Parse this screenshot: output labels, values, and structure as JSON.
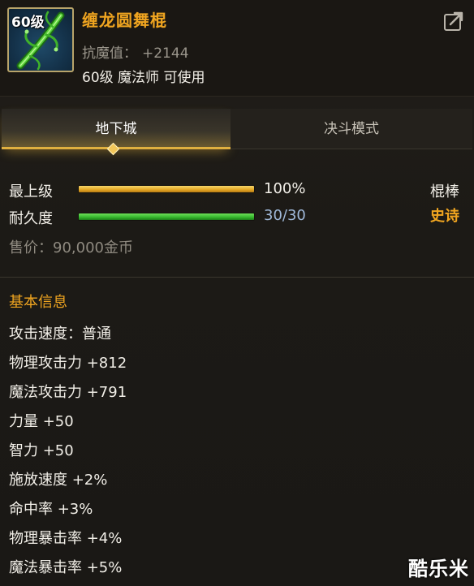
{
  "item": {
    "level_badge": "60级",
    "name": "缠龙圆舞棍",
    "resist_label": "抗魔值：",
    "resist_value": "+2144",
    "usable_by": "60级 魔法师 可使用",
    "icon": "green-vine-staff-icon"
  },
  "header": {
    "share_icon": "share-icon"
  },
  "tabs": [
    {
      "label": "地下城",
      "active": true
    },
    {
      "label": "决斗模式",
      "active": false
    }
  ],
  "stats": {
    "upgrade": {
      "label": "最上级",
      "value_text": "100%",
      "fill_fraction": 1.0,
      "color": "#e3a623"
    },
    "durability": {
      "label": "耐久度",
      "value_text": "30/30",
      "fill_fraction": 1.0,
      "color": "#33b52b"
    }
  },
  "weapon": {
    "type": "棍棒",
    "rarity": "史诗",
    "rarity_color": "#f0a520"
  },
  "price": "售价：90,000金币",
  "basic_info": {
    "title": "基本信息",
    "attributes": [
      "攻击速度：普通",
      "物理攻击力 +812",
      "魔法攻击力 +791",
      "力量 +50",
      "智力 +50",
      "施放速度 +2%",
      "命中率 +3%",
      "物理暴击率 +4%",
      "魔法暴击率 +5%"
    ]
  },
  "watermark": "酷乐米"
}
